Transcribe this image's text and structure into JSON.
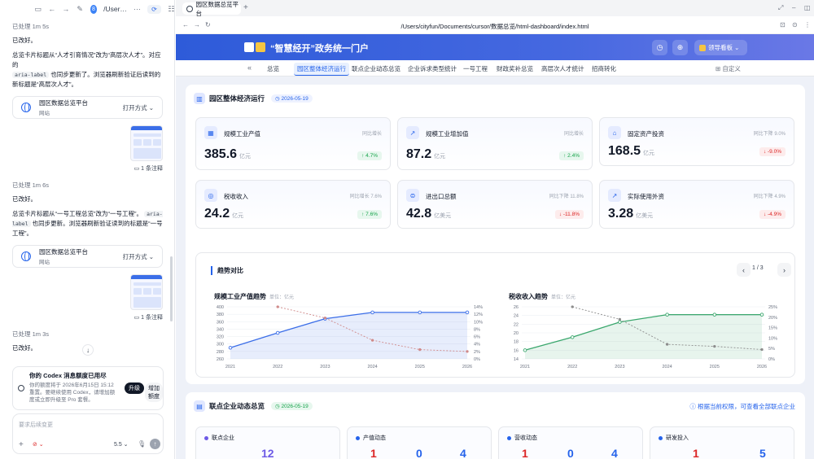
{
  "chat": {
    "toolbar": {
      "title": "/User…",
      "ellipsis": "···",
      "avatar": "8",
      "pill": "⟳"
    },
    "blocks": [
      {
        "meta": "已处理 1m 5s",
        "lines": [
          "已改好。",
          "总览卡片标题从“人才引育情况”改为“高层次人才”。对应的",
          "also-label",
          "也同步更新了。浏览器刷新验证后读到的新标题是“高层次人才”。"
        ]
      },
      {
        "meta": "已处理 1m 6s",
        "lines": [
          "已改好。",
          "总览卡片标题从“一号工程总览”改为“一号工程”。",
          "aria-label",
          "也同步更新。浏览器刷新验证读到的标题是“一号工程”。"
        ]
      },
      {
        "meta": "已处理 1m 3s",
        "lines": [
          "已改好。"
        ]
      }
    ],
    "link_card": {
      "name": "园区数据总览平台",
      "sub": "网站",
      "open": "打开方式 ⌄"
    },
    "notes": "▭ 1 条注释",
    "p1_a": "总览卡片标题从“人才引育情况”改为“高层次人才”。对应的",
    "p1_code": "aria-label",
    "p1_b": " 也同步更新了。浏览器刷新验证后读到的新标题是“高层次人才”。",
    "p2_a": "总览卡片标题从“一号工程总览”改为“一号工程”。",
    "p2_code": "aria-label",
    "p2_b": " 也同步更新。浏览器刷新验证读到的标题是“一号工程”。",
    "done": "已改好。",
    "meta1": "已处理 1m 5s",
    "meta2": "已处理 1m 6s",
    "meta3": "已处理 1m 3s",
    "limit": {
      "title": "你的 Codex 消息额度已用尽",
      "body": "你的额度将于 2026年6月15日 15:12重置。要继续使用 Codex，请增加额度或立即升级至 Pro 套餐。",
      "upgrade": "升级",
      "add": "增加额度"
    },
    "composer": {
      "placeholder": "要求后续变更",
      "plus": "+",
      "mode": "⊘ ⌄",
      "model": "5.5 ⌄",
      "mic": "🎙",
      "send": "↑"
    },
    "scroll_down": "↓"
  },
  "browser": {
    "tab_title": "园区数据总览平台",
    "new_tab": "+",
    "url": "/Users/cityfun/Documents/cursor/数据总览/html-dashboard/index.html"
  },
  "header": {
    "title": "“智慧经开”政务统一门户",
    "lead_label": "领导看板 ⌄"
  },
  "nav": {
    "collapse": "«",
    "items": [
      "总览",
      "园区整体经济运行",
      "联点企业动态总览",
      "企业诉求类型统计",
      "一号工程",
      "财政奖补总览",
      "高层次人才统计",
      "招商转化"
    ],
    "active_index": 1,
    "customize": "⊞ 自定义"
  },
  "section1": {
    "title": "园区整体经济运行",
    "date": "◷ 2026-05-19",
    "kpis": [
      {
        "name": "规模工业产值",
        "cmp": "同比增长",
        "value": "385.6",
        "unit": "亿元",
        "delta": "↑ 4.7%",
        "dir": "up"
      },
      {
        "name": "规模工业增加值",
        "cmp": "同比增长",
        "value": "87.2",
        "unit": "亿元",
        "delta": "↑ 2.4%",
        "dir": "up"
      },
      {
        "name": "固定资产投资",
        "cmp": "同比下降 9.0%",
        "value": "168.5",
        "unit": "亿元",
        "delta": "↓ -9.0%",
        "dir": "down"
      },
      {
        "name": "税收收入",
        "cmp": "同比增长 7.6%",
        "value": "24.2",
        "unit": "亿元",
        "delta": "↑ 7.6%",
        "dir": "up"
      },
      {
        "name": "进出口总额",
        "cmp": "同比下降 11.8%",
        "value": "42.8",
        "unit": "亿美元",
        "delta": "↓ -11.8%",
        "dir": "down"
      },
      {
        "name": "实际使用外资",
        "cmp": "同比下降 4.9%",
        "value": "3.28",
        "unit": "亿美元",
        "delta": "↓ -4.9%",
        "dir": "down"
      }
    ],
    "trend": {
      "title": "趋势对比",
      "page": "1 / 3",
      "prev": "‹",
      "next": "›"
    }
  },
  "chart_data": [
    {
      "type": "line",
      "title": "规模工业产值趋势",
      "unit": "单位：亿元",
      "categories": [
        "2021",
        "2022",
        "2023",
        "2024",
        "2025",
        "2026"
      ],
      "series": [
        {
          "axis": "left",
          "values": [
            290,
            330,
            368,
            385,
            385,
            385
          ],
          "color": "#3b6ee8"
        },
        {
          "axis": "right",
          "values": [
            null,
            14,
            11,
            5,
            2.5,
            2
          ],
          "color": "#d08a8a",
          "dashed": true
        }
      ],
      "yticks_left": [
        "400",
        "380",
        "360",
        "340",
        "320",
        "300",
        "280",
        "260"
      ],
      "yticks_right": [
        "14%",
        "12%",
        "10%",
        "8%",
        "6%",
        "4%",
        "2%",
        "0%"
      ],
      "ylim_left": [
        260,
        400
      ],
      "ylim_right": [
        0,
        14
      ]
    },
    {
      "type": "line",
      "title": "税收收入趋势",
      "unit": "单位：亿元",
      "categories": [
        "2021",
        "2022",
        "2023",
        "2024",
        "2025",
        "2026"
      ],
      "series": [
        {
          "axis": "left",
          "values": [
            16,
            19,
            22.5,
            24.2,
            24.2,
            24.2
          ],
          "color": "#3aa76d"
        },
        {
          "axis": "right",
          "values": [
            null,
            25,
            19,
            7,
            6,
            4.5
          ],
          "color": "#8c8c8c",
          "dashed": true
        }
      ],
      "yticks_left": [
        "26",
        "24",
        "22",
        "20",
        "18",
        "16",
        "14"
      ],
      "yticks_right": [
        "25%",
        "20%",
        "15%",
        "10%",
        "5%",
        "0%"
      ],
      "ylim_left": [
        14,
        26
      ],
      "ylim_right": [
        0,
        25
      ]
    }
  ],
  "section2": {
    "title": "联点企业动态总览",
    "date": "◷ 2026-05-19",
    "hint": "ⓘ 根据当前权限，可查看全部联点企业",
    "cards": [
      {
        "title": "联点企业",
        "dot": "#6d5ae6",
        "values": [
          "12"
        ],
        "colors": [
          "#6d5ae6"
        ]
      },
      {
        "title": "产值动态",
        "dot": "#2563eb",
        "values": [
          "1",
          "0",
          "4"
        ],
        "colors": [
          "#dc2626",
          "#2563eb",
          "#2563eb"
        ]
      },
      {
        "title": "营收动态",
        "dot": "#2563eb",
        "values": [
          "1",
          "0",
          "4"
        ],
        "colors": [
          "#dc2626",
          "#2563eb",
          "#2563eb"
        ]
      },
      {
        "title": "研发投入",
        "dot": "#2563eb",
        "values": [
          "1",
          "5"
        ],
        "colors": [
          "#dc2626",
          "#2563eb"
        ]
      }
    ]
  }
}
